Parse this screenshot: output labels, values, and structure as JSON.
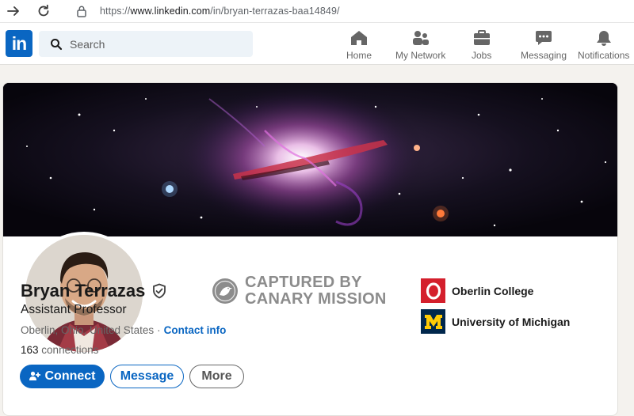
{
  "browser": {
    "url_prefix": "https://",
    "url_host": "www.linkedin.com",
    "url_path": "/in/bryan-terrazas-baa14849/"
  },
  "nav": {
    "logo": "in",
    "search_placeholder": "Search",
    "items": [
      {
        "label": "Home",
        "icon": "home-icon"
      },
      {
        "label": "My Network",
        "icon": "network-icon"
      },
      {
        "label": "Jobs",
        "icon": "briefcase-icon"
      },
      {
        "label": "Messaging",
        "icon": "chat-icon"
      },
      {
        "label": "Notifications",
        "icon": "bell-icon"
      }
    ]
  },
  "profile": {
    "name": "Bryan Terrazas",
    "headline": "Assistant Professor",
    "location": "Oberlin, Ohio, United States",
    "separator": "·",
    "contact_label": "Contact info",
    "connections_count": "163",
    "connections_label": "connections",
    "buttons": {
      "connect": "Connect",
      "message": "Message",
      "more": "More"
    }
  },
  "watermark": {
    "line1": "CAPTURED BY",
    "line2": "CANARY MISSION"
  },
  "education": [
    {
      "name": "Oberlin College",
      "logo_letter": "O",
      "color": "#d41f2c"
    },
    {
      "name": "University of Michigan",
      "logo_letter": "M",
      "color": "#00274c"
    }
  ],
  "colors": {
    "accent": "#0a66c2",
    "text": "#191919",
    "muted": "#666666"
  }
}
